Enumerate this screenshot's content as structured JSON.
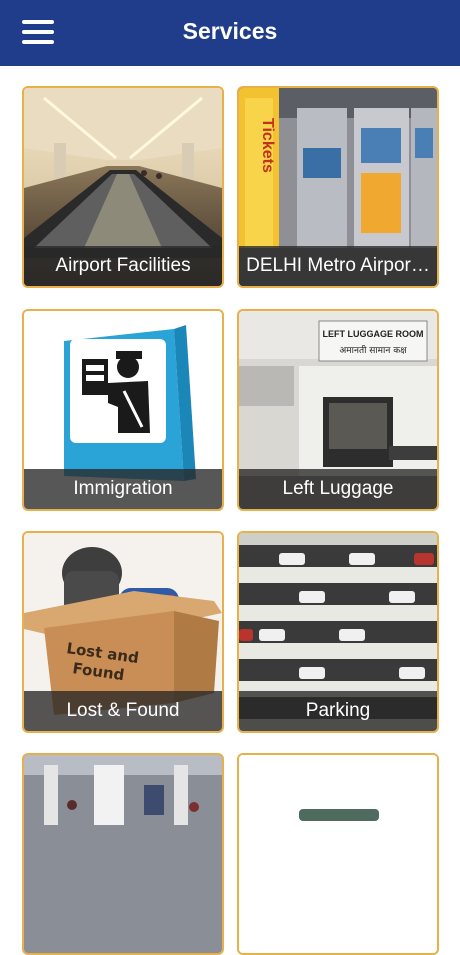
{
  "header": {
    "title": "Services",
    "menu_icon": "hamburger-menu-icon",
    "background": "#1f3d8a"
  },
  "tiles": [
    {
      "label": "Airport Facilities",
      "image": "airport-terminal-travelator"
    },
    {
      "label": "DELHI Metro Airpor…",
      "image": "metro-ticket-machines"
    },
    {
      "label": "Immigration",
      "image": "immigration-officer-icon"
    },
    {
      "label": "Left Luggage",
      "image": "left-luggage-room"
    },
    {
      "label": "Lost & Found",
      "image": "lost-and-found-box"
    },
    {
      "label": "Parking",
      "image": "multilevel-parking"
    },
    {
      "label": "",
      "image": "terminal-gate-area"
    },
    {
      "label": "",
      "image": "vehicle-partial"
    }
  ],
  "images_text": {
    "metro_banner": "Tickets",
    "luggage_sign_en": "LEFT LUGGAGE ROOM",
    "luggage_sign_hi": "अमानती सामान कक्ष",
    "box_text_1": "Lost and",
    "box_text_2": "Found"
  },
  "accent_border": "#e8b04a"
}
